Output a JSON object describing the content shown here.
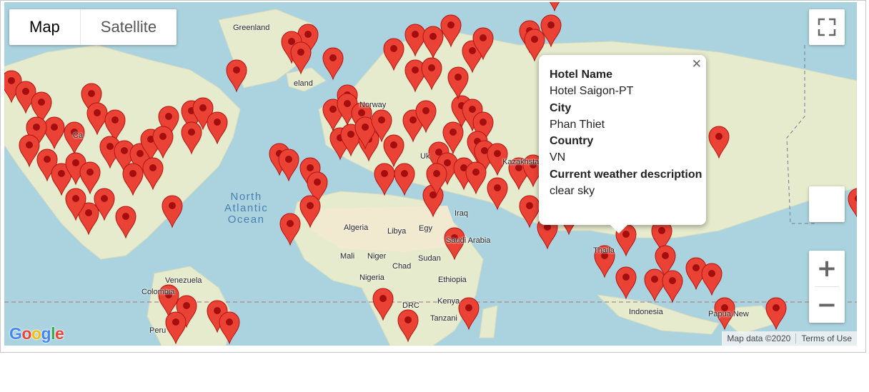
{
  "map_type_control": {
    "map_label": "Map",
    "satellite_label": "Satellite",
    "selected": "Map"
  },
  "info_window": {
    "fields": [
      {
        "label": "Hotel Name",
        "value": "Hotel Saigon-PT"
      },
      {
        "label": "City",
        "value": "Phan Thiet"
      },
      {
        "label": "Country",
        "value": "VN"
      },
      {
        "label": "Current weather description",
        "value": "clear sky"
      }
    ],
    "close_icon": "close-icon"
  },
  "zoom": {
    "in_symbol": "+",
    "out_symbol": "−"
  },
  "attribution": {
    "map_data": "Map data ©2020",
    "terms": "Terms of Use"
  },
  "logo": "Google",
  "map_labels": {
    "greenland": "Greenland",
    "norway": "Norway",
    "kazakhstan": "Kazakhstan",
    "north_atlantic_ocean": "North\nAtlantic\nOcean",
    "algeria": "Algeria",
    "libya": "Libya",
    "egypt": "Egy",
    "mali": "Mali",
    "niger": "Niger",
    "sudan": "Sudan",
    "chad": "Chad",
    "nigeria": "Nigeria",
    "ethiopia": "Ethiopia",
    "saudi_arabia": "Saudi Arabia",
    "iraq": "Iraq",
    "kenya": "Kenya",
    "drc": "DRC",
    "tanzania": "Tanzani",
    "venezuela": "Venezuela",
    "colombia": "Colombia",
    "peru": "Peru",
    "thailand": "Thaila",
    "indonesia": "Indonesia",
    "papua_new_guinea": "Papua New",
    "uk": "Uk",
    "ireland": "eland",
    "canada": "Ca"
  },
  "colors": {
    "water": "#aad3df",
    "land": "#e8eccf",
    "marker": "#ea4335",
    "marker_dot": "#a50e0e"
  },
  "markers_description": "dense red map-pin markers on cities"
}
